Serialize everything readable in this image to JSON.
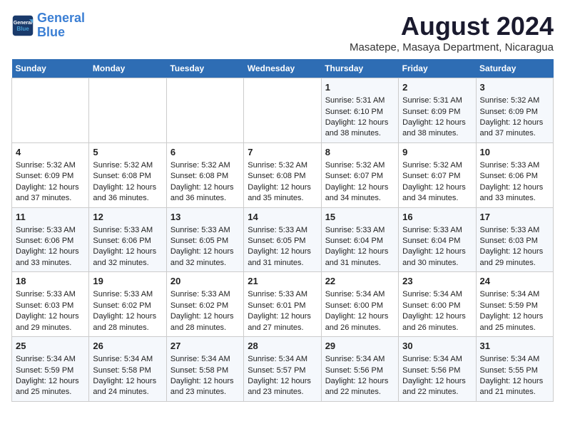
{
  "header": {
    "logo_line1": "General",
    "logo_line2": "Blue",
    "title": "August 2024",
    "subtitle": "Masatepe, Masaya Department, Nicaragua"
  },
  "weekdays": [
    "Sunday",
    "Monday",
    "Tuesday",
    "Wednesday",
    "Thursday",
    "Friday",
    "Saturday"
  ],
  "weeks": [
    [
      {
        "day": "",
        "info": ""
      },
      {
        "day": "",
        "info": ""
      },
      {
        "day": "",
        "info": ""
      },
      {
        "day": "",
        "info": ""
      },
      {
        "day": "1",
        "info": "Sunrise: 5:31 AM\nSunset: 6:10 PM\nDaylight: 12 hours\nand 38 minutes."
      },
      {
        "day": "2",
        "info": "Sunrise: 5:31 AM\nSunset: 6:09 PM\nDaylight: 12 hours\nand 38 minutes."
      },
      {
        "day": "3",
        "info": "Sunrise: 5:32 AM\nSunset: 6:09 PM\nDaylight: 12 hours\nand 37 minutes."
      }
    ],
    [
      {
        "day": "4",
        "info": "Sunrise: 5:32 AM\nSunset: 6:09 PM\nDaylight: 12 hours\nand 37 minutes."
      },
      {
        "day": "5",
        "info": "Sunrise: 5:32 AM\nSunset: 6:08 PM\nDaylight: 12 hours\nand 36 minutes."
      },
      {
        "day": "6",
        "info": "Sunrise: 5:32 AM\nSunset: 6:08 PM\nDaylight: 12 hours\nand 36 minutes."
      },
      {
        "day": "7",
        "info": "Sunrise: 5:32 AM\nSunset: 6:08 PM\nDaylight: 12 hours\nand 35 minutes."
      },
      {
        "day": "8",
        "info": "Sunrise: 5:32 AM\nSunset: 6:07 PM\nDaylight: 12 hours\nand 34 minutes."
      },
      {
        "day": "9",
        "info": "Sunrise: 5:32 AM\nSunset: 6:07 PM\nDaylight: 12 hours\nand 34 minutes."
      },
      {
        "day": "10",
        "info": "Sunrise: 5:33 AM\nSunset: 6:06 PM\nDaylight: 12 hours\nand 33 minutes."
      }
    ],
    [
      {
        "day": "11",
        "info": "Sunrise: 5:33 AM\nSunset: 6:06 PM\nDaylight: 12 hours\nand 33 minutes."
      },
      {
        "day": "12",
        "info": "Sunrise: 5:33 AM\nSunset: 6:06 PM\nDaylight: 12 hours\nand 32 minutes."
      },
      {
        "day": "13",
        "info": "Sunrise: 5:33 AM\nSunset: 6:05 PM\nDaylight: 12 hours\nand 32 minutes."
      },
      {
        "day": "14",
        "info": "Sunrise: 5:33 AM\nSunset: 6:05 PM\nDaylight: 12 hours\nand 31 minutes."
      },
      {
        "day": "15",
        "info": "Sunrise: 5:33 AM\nSunset: 6:04 PM\nDaylight: 12 hours\nand 31 minutes."
      },
      {
        "day": "16",
        "info": "Sunrise: 5:33 AM\nSunset: 6:04 PM\nDaylight: 12 hours\nand 30 minutes."
      },
      {
        "day": "17",
        "info": "Sunrise: 5:33 AM\nSunset: 6:03 PM\nDaylight: 12 hours\nand 29 minutes."
      }
    ],
    [
      {
        "day": "18",
        "info": "Sunrise: 5:33 AM\nSunset: 6:03 PM\nDaylight: 12 hours\nand 29 minutes."
      },
      {
        "day": "19",
        "info": "Sunrise: 5:33 AM\nSunset: 6:02 PM\nDaylight: 12 hours\nand 28 minutes."
      },
      {
        "day": "20",
        "info": "Sunrise: 5:33 AM\nSunset: 6:02 PM\nDaylight: 12 hours\nand 28 minutes."
      },
      {
        "day": "21",
        "info": "Sunrise: 5:33 AM\nSunset: 6:01 PM\nDaylight: 12 hours\nand 27 minutes."
      },
      {
        "day": "22",
        "info": "Sunrise: 5:34 AM\nSunset: 6:00 PM\nDaylight: 12 hours\nand 26 minutes."
      },
      {
        "day": "23",
        "info": "Sunrise: 5:34 AM\nSunset: 6:00 PM\nDaylight: 12 hours\nand 26 minutes."
      },
      {
        "day": "24",
        "info": "Sunrise: 5:34 AM\nSunset: 5:59 PM\nDaylight: 12 hours\nand 25 minutes."
      }
    ],
    [
      {
        "day": "25",
        "info": "Sunrise: 5:34 AM\nSunset: 5:59 PM\nDaylight: 12 hours\nand 25 minutes."
      },
      {
        "day": "26",
        "info": "Sunrise: 5:34 AM\nSunset: 5:58 PM\nDaylight: 12 hours\nand 24 minutes."
      },
      {
        "day": "27",
        "info": "Sunrise: 5:34 AM\nSunset: 5:58 PM\nDaylight: 12 hours\nand 23 minutes."
      },
      {
        "day": "28",
        "info": "Sunrise: 5:34 AM\nSunset: 5:57 PM\nDaylight: 12 hours\nand 23 minutes."
      },
      {
        "day": "29",
        "info": "Sunrise: 5:34 AM\nSunset: 5:56 PM\nDaylight: 12 hours\nand 22 minutes."
      },
      {
        "day": "30",
        "info": "Sunrise: 5:34 AM\nSunset: 5:56 PM\nDaylight: 12 hours\nand 22 minutes."
      },
      {
        "day": "31",
        "info": "Sunrise: 5:34 AM\nSunset: 5:55 PM\nDaylight: 12 hours\nand 21 minutes."
      }
    ]
  ]
}
